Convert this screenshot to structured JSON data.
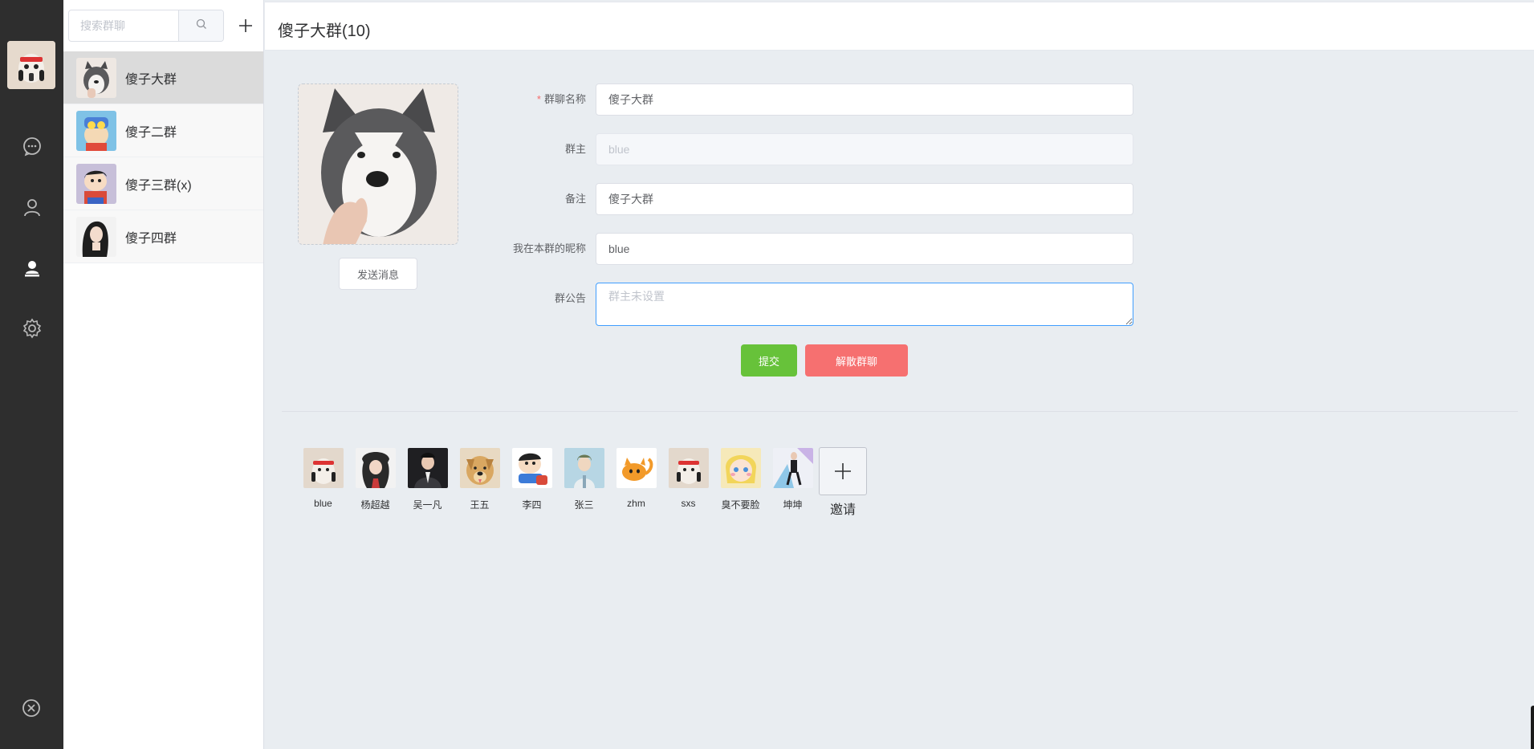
{
  "rail": {
    "icons": [
      "chat-icon",
      "user-icon",
      "contacts-icon",
      "settings-icon",
      "logout-icon"
    ]
  },
  "search": {
    "placeholder": "搜索群聊"
  },
  "groups": [
    {
      "name": "傻子大群"
    },
    {
      "name": "傻子二群"
    },
    {
      "name": "傻子三群(x)"
    },
    {
      "name": "傻子四群"
    }
  ],
  "header": {
    "title": "傻子大群(10)"
  },
  "profile": {
    "send_label": "发送消息"
  },
  "form": {
    "name_label": "群聊名称",
    "name_value": "傻子大群",
    "owner_label": "群主",
    "owner_value": "blue",
    "remark_label": "备注",
    "remark_value": "傻子大群",
    "nickname_label": "我在本群的昵称",
    "nickname_value": "blue",
    "notice_label": "群公告",
    "notice_placeholder": "群主未设置",
    "submit_label": "提交",
    "dissolve_label": "解散群聊"
  },
  "members": [
    {
      "name": "blue"
    },
    {
      "name": "杨超越"
    },
    {
      "name": "吴一凡"
    },
    {
      "name": "王五"
    },
    {
      "name": "李四"
    },
    {
      "name": "张三"
    },
    {
      "name": "zhm"
    },
    {
      "name": "sxs"
    },
    {
      "name": "臭不要脸"
    },
    {
      "name": "坤坤"
    }
  ],
  "invite_label": "邀请",
  "colors": {
    "rail": "#2e2e2e",
    "submit": "#67c23a",
    "dissolve": "#f67070",
    "focus": "#409eff"
  }
}
